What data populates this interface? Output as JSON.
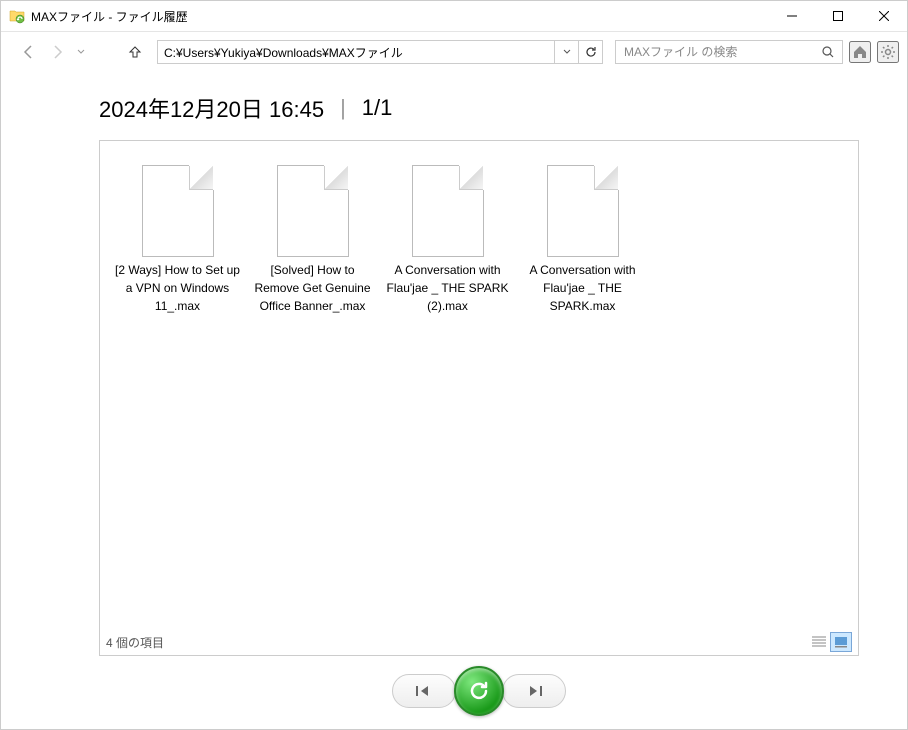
{
  "window": {
    "title": "MAXファイル - ファイル履歴"
  },
  "toolbar": {
    "path": "C:¥Users¥Yukiya¥Downloads¥MAXファイル",
    "search_placeholder": "MAXファイル の検索"
  },
  "heading": {
    "datetime": "2024年12月20日 16:45",
    "separator": "|",
    "page": "1/1"
  },
  "files": [
    {
      "name": "[2 Ways] How to Set up a VPN on Windows 11_.max"
    },
    {
      "name": "[Solved] How to Remove Get Genuine Office Banner_.max"
    },
    {
      "name": "A Conversation with Flau'jae _ THE SPARK (2).max"
    },
    {
      "name": "A Conversation with Flau'jae _ THE SPARK.max"
    }
  ],
  "footer": {
    "count_label": "4 個の項目"
  }
}
